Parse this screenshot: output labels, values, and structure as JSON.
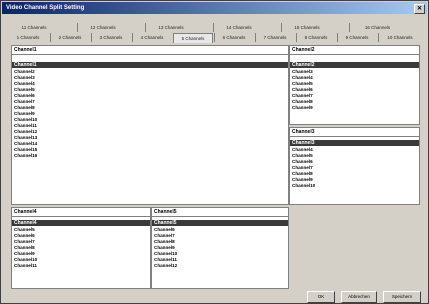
{
  "window": {
    "title": "Video Channel Split Setting",
    "close_glyph": "✕"
  },
  "tabs_top": [
    "11 Channels",
    "12 Channels",
    "13 Channels",
    "14 Channels",
    "15 Channels",
    "16 Channels"
  ],
  "tabs_bottom": [
    "1 Channels",
    "2 Channels",
    "3 Channels",
    "4 Channels",
    "5 Channels",
    "6 Channels",
    "7 Channels",
    "8 Channels",
    "9 Channels",
    "10 Channels"
  ],
  "panels": {
    "p1": {
      "header": "Channel1",
      "selected": "Channel1",
      "items": [
        "Channel2",
        "Channel3",
        "Channel4",
        "Channel5",
        "Channel6",
        "Channel7",
        "Channel8",
        "Channel9",
        "Channel10",
        "Channel11",
        "Channel12",
        "Channel13",
        "Channel14",
        "Channel15",
        "Channel16"
      ]
    },
    "p2": {
      "header": "Channel2",
      "selected": "Channel2",
      "items": [
        "Channel3",
        "Channel4",
        "Channel5",
        "Channel6",
        "Channel7",
        "Channel8",
        "Channel9"
      ]
    },
    "p3": {
      "header": "Channel3",
      "selected": "Channel3",
      "items": [
        "Channel4",
        "Channel5",
        "Channel6",
        "Channel7",
        "Channel8",
        "Channel9",
        "Channel10"
      ]
    },
    "p4": {
      "header": "Channel4",
      "selected": "Channel4",
      "items": [
        "Channel5",
        "Channel6",
        "Channel7",
        "Channel8",
        "Channel9",
        "Channel10",
        "Channel11"
      ]
    },
    "p5": {
      "header": "Channel5",
      "selected": "Channel5",
      "items": [
        "Channel6",
        "Channel7",
        "Channel8",
        "Channel9",
        "Channel10",
        "Channel11",
        "Channel12"
      ]
    }
  },
  "buttons": {
    "ok": "OK",
    "cancel": "Abbrechen",
    "save": "Speichern"
  }
}
